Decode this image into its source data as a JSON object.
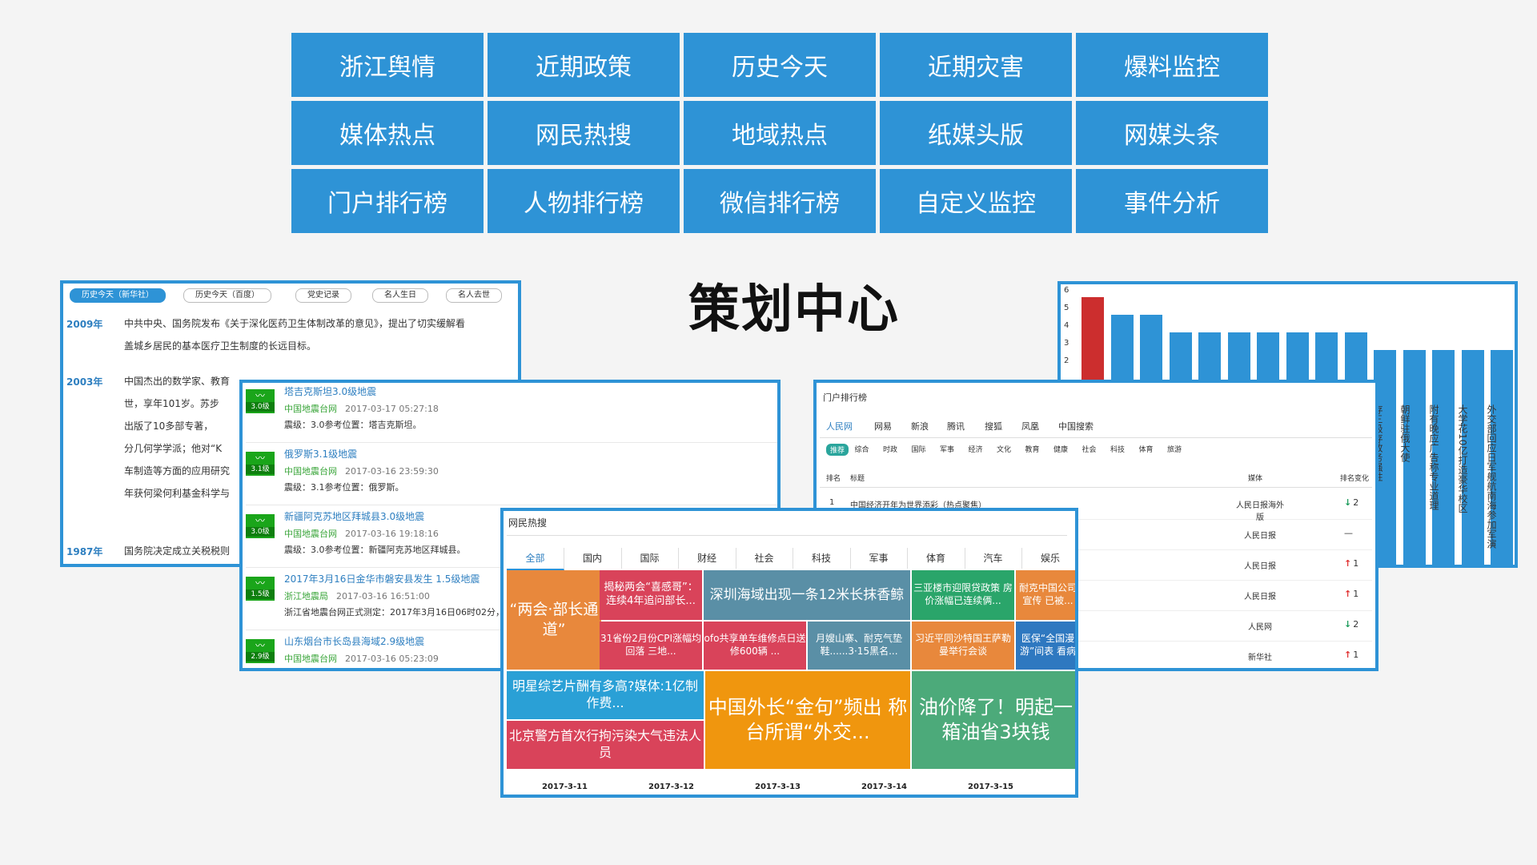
{
  "tiles": [
    "浙江舆情",
    "近期政策",
    "历史今天",
    "近期灾害",
    "爆料监控",
    "媒体热点",
    "网民热搜",
    "地域热点",
    "纸媒头版",
    "网媒头条",
    "门户排行榜",
    "人物排行榜",
    "微信排行榜",
    "自定义监控",
    "事件分析"
  ],
  "center_title": "策划中心",
  "history": {
    "tabs": [
      "历史今天（新华社）",
      "历史今天（百度）",
      "党史记录",
      "名人生日",
      "名人去世"
    ],
    "entries": [
      {
        "year": "2009年",
        "lines": [
          "中共中央、国务院发布《关于深化医药卫生体制改革的意见》，提出了切实缓解看",
          "盖城乡居民的基本医疗卫生制度的长远目标。"
        ]
      },
      {
        "year": "2003年",
        "lines": [
          "中国杰出的数学家、教育",
          "世，享年101岁。苏步",
          "出版了10多部专著，",
          "分几何学学派；他对“K",
          "车制造等方面的应用研究",
          "年获何梁何利基金科学与"
        ]
      },
      {
        "year": "1987年",
        "lines": [
          "国务院决定成立关税税则"
        ]
      }
    ]
  },
  "quakes": [
    {
      "title": "塔吉克斯坦3.0级地震",
      "source": "中国地震台网",
      "time": "2017-03-17 05:27:18",
      "detail": "震级：3.0参考位置：塔吉克斯坦。",
      "mag": "3.0级"
    },
    {
      "title": "俄罗斯3.1级地震",
      "source": "中国地震台网",
      "time": "2017-03-16 23:59:30",
      "detail": "震级：3.1参考位置：俄罗斯。",
      "mag": "3.1级"
    },
    {
      "title": "新疆阿克苏地区拜城县3.0级地震",
      "source": "中国地震台网",
      "time": "2017-03-16 19:18:16",
      "detail": "震级：3.0参考位置：新疆阿克苏地区拜城县。",
      "mag": "3.0级"
    },
    {
      "title": "2017年3月16日金华市磐安县发生 1.5级地震",
      "source": "浙江地震局",
      "time": "2017-03-16 16:51:00",
      "detail": "浙江省地震台网正式测定：2017年3月16日06时02分，",
      "mag": "1.5级"
    },
    {
      "title": "山东烟台市长岛县海域2.9级地震",
      "source": "中国地震台网",
      "time": "2017-03-16 05:23:09",
      "detail": "",
      "mag": "2.9级"
    }
  ],
  "chart_data": {
    "type": "bar",
    "yticks": [
      "6",
      "5",
      "4",
      "3",
      "2"
    ],
    "ylim": [
      0,
      6
    ],
    "values": [
      6,
      5,
      5,
      4,
      4,
      4,
      4,
      4,
      4,
      4,
      3,
      3,
      3,
      3,
      3
    ],
    "highlight_color": "#cc2e2e",
    "bar_color": "#2e93d6",
    "categories_visible": [
      "存三极存政务强胜",
      "朝鲜驻俄大使",
      "附有晚应广告称专业道理",
      "大学花10亿打造豪华校区",
      "外交部回应日军舰航南海参加军演"
    ]
  },
  "portal": {
    "title": "门户排行榜",
    "tabs": [
      "人民网",
      "网易",
      "新浪",
      "腾讯",
      "搜狐",
      "凤凰",
      "中国搜索"
    ],
    "subtabs": [
      "推荐",
      "综合",
      "时政",
      "国际",
      "军事",
      "经济",
      "文化",
      "教育",
      "健康",
      "社会",
      "科技",
      "体育",
      "旅游"
    ],
    "headers": [
      "排名",
      "标题",
      "媒体",
      "排名变化"
    ],
    "rows": [
      {
        "rank": "1",
        "title": "中国经济开年为世界添彩（热点聚焦）",
        "source": "人民日报海外版",
        "change": "2",
        "dir": "down"
      },
      {
        "rank": "",
        "title": "",
        "source": "人民日报",
        "change": "—",
        "dir": "none"
      },
      {
        "rank": "",
        "title": "",
        "source": "人民日报",
        "change": "1",
        "dir": "up"
      },
      {
        "rank": "",
        "title": "",
        "source": "人民日报",
        "change": "1",
        "dir": "up"
      },
      {
        "rank": "",
        "title": "",
        "source": "人民网",
        "change": "2",
        "dir": "down"
      },
      {
        "rank": "",
        "title": "",
        "source": "新华社",
        "change": "1",
        "dir": "up"
      }
    ]
  },
  "hotsearch": {
    "title": "网民热搜",
    "tabs": [
      "全部",
      "国内",
      "国际",
      "财经",
      "社会",
      "科技",
      "军事",
      "体育",
      "汽车",
      "娱乐"
    ],
    "cells": [
      {
        "text": "“两会·部长通道”",
        "color": "#e8883c"
      },
      {
        "text": "揭秘两会“喜感哥”：连续4年追问部长...",
        "color": "#d9435a"
      },
      {
        "text": "深圳海域出现一条12米长抹香鲸",
        "color": "#5a8fa6"
      },
      {
        "text": "三亚楼市迎限贷政策 房价涨幅已连续俩...",
        "color": "#2aa56a"
      },
      {
        "text": "耐克中国公司宣传 已被...",
        "color": "#e8883c"
      },
      {
        "text": "31省份2月份CPI涨幅均回落 三地...",
        "color": "#d9435a"
      },
      {
        "text": "ofo共享单车维修点日送修600辆 ...",
        "color": "#d9435a"
      },
      {
        "text": "月嫂山寨、耐克气垫鞋......3·15黑名...",
        "color": "#5a8fa6"
      },
      {
        "text": "习近平同沙特国王萨勒曼举行会谈",
        "color": "#e8883c"
      },
      {
        "text": "医保“全国漫游”间表 看病",
        "color": "#2e78c0"
      },
      {
        "text": "明星综艺片酬有多高?媒体:1亿制作费...",
        "color": "#2aa0d6"
      },
      {
        "text": "北京警方首次行拘污染大气违法人员",
        "color": "#d9435a"
      },
      {
        "text": "中国外长“金句”频出 称台所谓“外交...",
        "color": "#f0960e"
      },
      {
        "text": "油价降了！明起一箱油省3块钱",
        "color": "#4caa7a"
      }
    ],
    "dates": [
      "2017-3-11",
      "2017-3-12",
      "2017-3-13",
      "2017-3-14",
      "2017-3-15"
    ]
  }
}
